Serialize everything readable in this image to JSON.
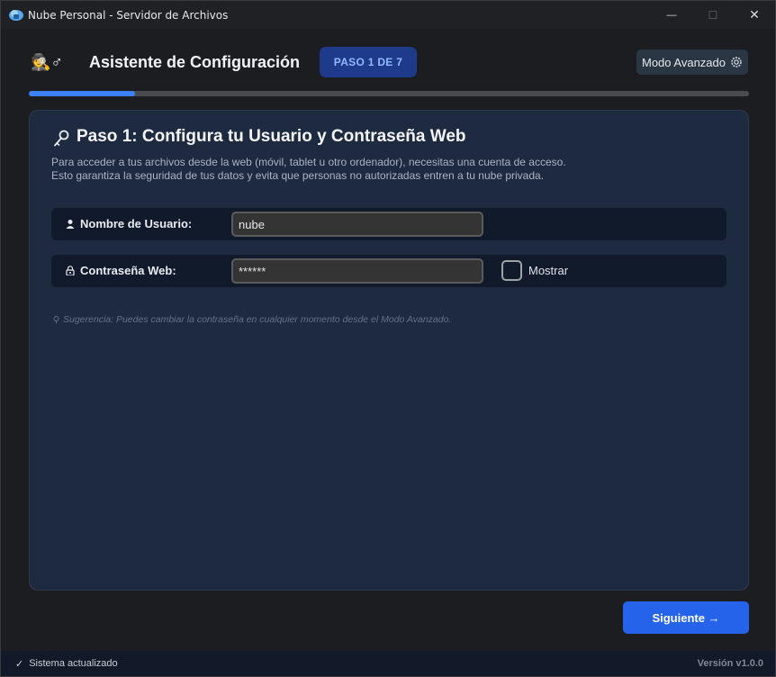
{
  "window": {
    "title": "Nube Personal - Servidor de Archivos",
    "controls": {
      "minimize": "—",
      "maximize": "☐",
      "close": "✕"
    }
  },
  "header": {
    "icon_glyph": "🕵♂",
    "title": "Asistente de Configuración",
    "step_badge": "PASO 1 DE 7",
    "advanced_button": "Modo Avanzado",
    "progress_fraction": 0.147
  },
  "card": {
    "title": "Paso 1: Configura tu Usuario y Contraseña Web",
    "description_line1": "Para acceder a tus archivos desde la web (móvil, tablet u otro ordenador), necesitas una cuenta de acceso.",
    "description_line2": "Esto garantiza la seguridad de tus datos y evita que personas no autorizadas entren a tu nube privada.",
    "fields": {
      "username": {
        "label": "Nombre de Usuario:",
        "value": "nube"
      },
      "password": {
        "label": "Contraseña Web:",
        "value": "******",
        "show_label": "Mostrar",
        "show_checked": false
      }
    },
    "hint": "Sugerencia: Puedes cambiar la contraseña en cualquier momento desde el Modo Avanzado."
  },
  "footer": {
    "next_button": "Siguiente →",
    "status_check": "✓",
    "status_text": "Sistema actualizado",
    "version": "Versión v1.0.0"
  },
  "colors": {
    "accent": "#3b82f6",
    "button": "#2563eb",
    "badge_bg": "#1e3a8a",
    "card_bg": "#1d2a3f"
  }
}
